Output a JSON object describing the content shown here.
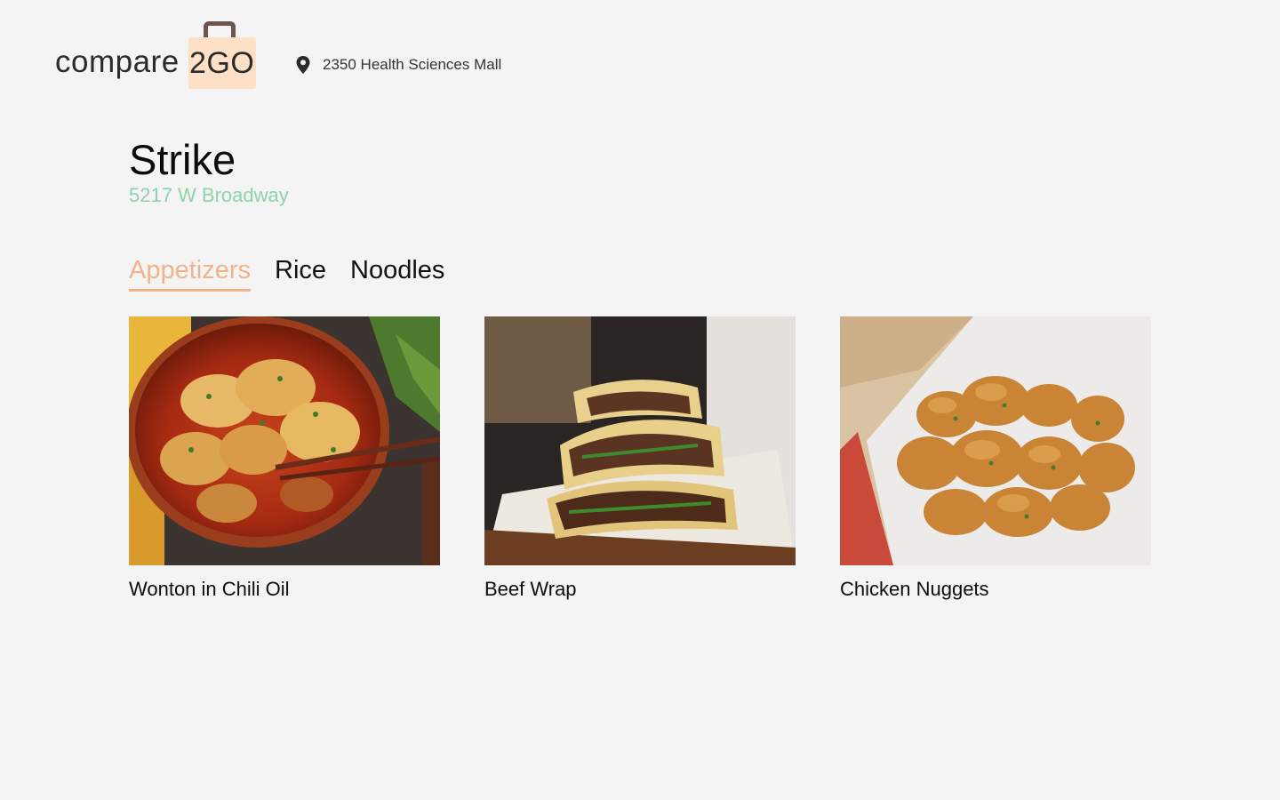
{
  "header": {
    "logo_word": "compare",
    "logo_bag_text": "2GO",
    "location_icon": "map-pin-icon",
    "location": "2350 Health Sciences Mall"
  },
  "restaurant": {
    "name": "Strike",
    "address": "5217 W Broadway"
  },
  "tabs": [
    {
      "label": "Appetizers",
      "active": true
    },
    {
      "label": "Rice",
      "active": false
    },
    {
      "label": "Noodles",
      "active": false
    }
  ],
  "items": [
    {
      "name": "Wonton in Chili Oil"
    },
    {
      "name": "Beef Wrap"
    },
    {
      "name": "Chicken Nuggets"
    }
  ],
  "colors": {
    "accent_tab": "#f0b48d",
    "address_green": "#8fd3aa",
    "logo_bag": "#fde0c6",
    "logo_handle": "#6b554c",
    "background": "#f4f4f4"
  }
}
